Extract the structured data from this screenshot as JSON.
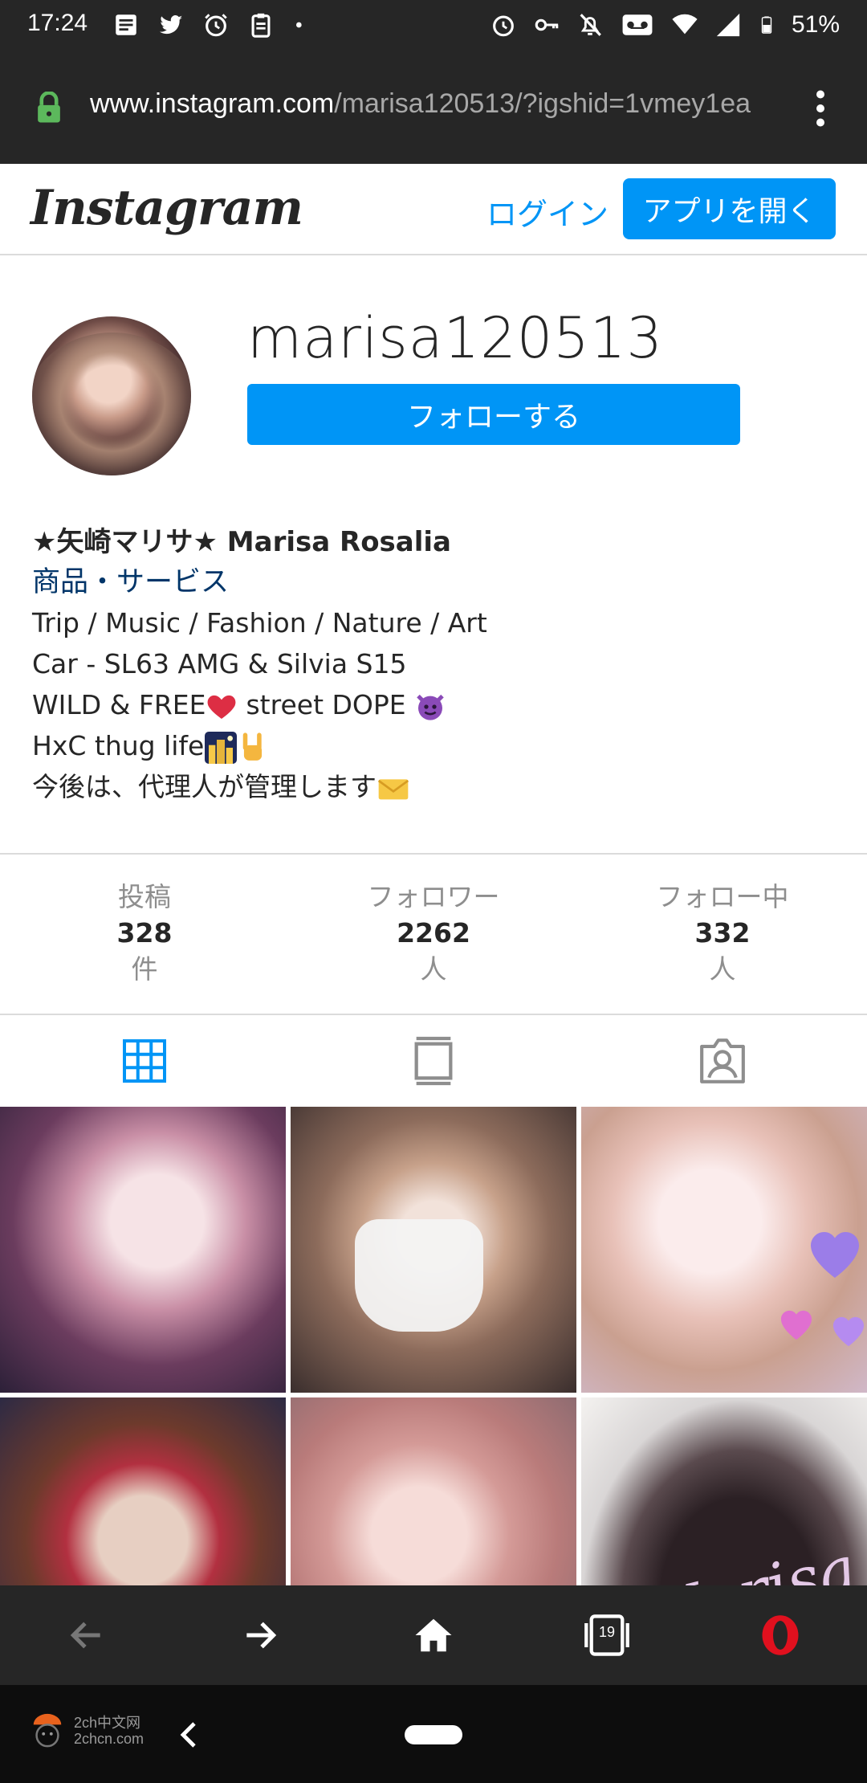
{
  "status_bar": {
    "time": "17:24",
    "battery": "51%",
    "left_icons": [
      "news-icon",
      "twitter-icon",
      "alarm-icon",
      "clipboard-icon",
      "dot-icon"
    ],
    "right_icons": [
      "alarm-icon",
      "key-icon",
      "bell-off-icon",
      "voicemail-icon",
      "wifi-icon",
      "signal-icon",
      "battery-icon"
    ]
  },
  "browser": {
    "url_host": "www.instagram.com",
    "url_path": "/marisa120513/?igshid=1vmey1ea",
    "tab_count": "19"
  },
  "header": {
    "logo": "Instagram",
    "login_label": "ログイン",
    "open_app_label": "アプリを開く"
  },
  "profile": {
    "username": "marisa120513",
    "follow_label": "フォローする",
    "full_name": "★矢崎マリサ★ Marisa Rosalia",
    "category": "商品・サービス",
    "bio_lines": [
      "Trip / Music / Fashion / Nature / Art",
      "Car - SL63 AMG & Silvia S15",
      "WILD & FREE",
      "street DOPE ",
      "HxC thug life",
      "今後は、代理人が管理します"
    ]
  },
  "stats": [
    {
      "label": "投稿",
      "value": "328",
      "unit": "件"
    },
    {
      "label": "フォロワー",
      "value": "2262",
      "unit": "人"
    },
    {
      "label": "フォロー中",
      "value": "332",
      "unit": "人"
    }
  ],
  "tabs": [
    "grid-icon",
    "feed-icon",
    "tagged-icon"
  ],
  "grid_photo_text": "Marisa",
  "watermark": {
    "line1": "2ch中文网",
    "line2": "2chcn.com"
  },
  "colors": {
    "accent": "#0095f6",
    "dark_bar": "#262626",
    "category_link": "#003569",
    "muted": "#8e8e8e",
    "opera_red": "#e0101e"
  }
}
